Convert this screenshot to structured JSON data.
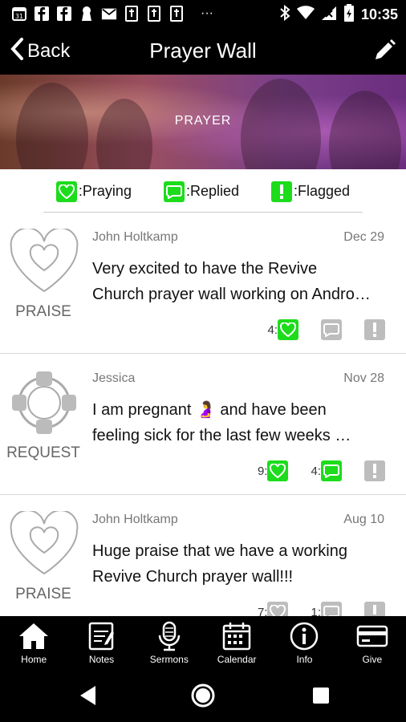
{
  "status_bar": {
    "time": "10:35",
    "more_dots": "···"
  },
  "header": {
    "back_label": "Back",
    "title": "Prayer Wall"
  },
  "banner": {
    "label": "PRAYER"
  },
  "legend": [
    {
      "label": ":Praying",
      "icon": "heart-icon"
    },
    {
      "label": ":Replied",
      "icon": "chat-bubble-icon"
    },
    {
      "label": ":Flagged",
      "icon": "exclamation-icon"
    }
  ],
  "posts": [
    {
      "type": "PRAISE",
      "author": "John Holtkamp",
      "date": "Dec 29",
      "text": "Very excited to have the Revive\nChurch prayer wall working on Andro…",
      "praying_count": "4:",
      "replied_count": "",
      "type_icon": "heart-outline-icon"
    },
    {
      "type": "REQUEST",
      "author": "Jessica",
      "date": "Nov 28",
      "text": "I am pregnant 🤰 and have been\nfeeling sick for the last few weeks …",
      "praying_count": "9:",
      "replied_count": "4:",
      "type_icon": "lifebuoy-icon"
    },
    {
      "type": "PRAISE",
      "author": "John Holtkamp",
      "date": "Aug 10",
      "text": "Huge praise that we have a working\nRevive Church prayer wall!!!",
      "praying_count": "7:",
      "replied_count": "1:",
      "type_icon": "heart-outline-icon"
    }
  ],
  "tabs": [
    {
      "label": "Home",
      "icon": "home-icon"
    },
    {
      "label": "Notes",
      "icon": "notes-icon"
    },
    {
      "label": "Sermons",
      "icon": "microphone-icon"
    },
    {
      "label": "Calendar",
      "icon": "calendar-icon"
    },
    {
      "label": "Info",
      "icon": "info-icon"
    },
    {
      "label": "Give",
      "icon": "credit-card-icon"
    }
  ],
  "colors": {
    "accent_green": "#1cdc1c",
    "inactive_gray": "#bdbdbd",
    "bar_black": "#000000"
  }
}
